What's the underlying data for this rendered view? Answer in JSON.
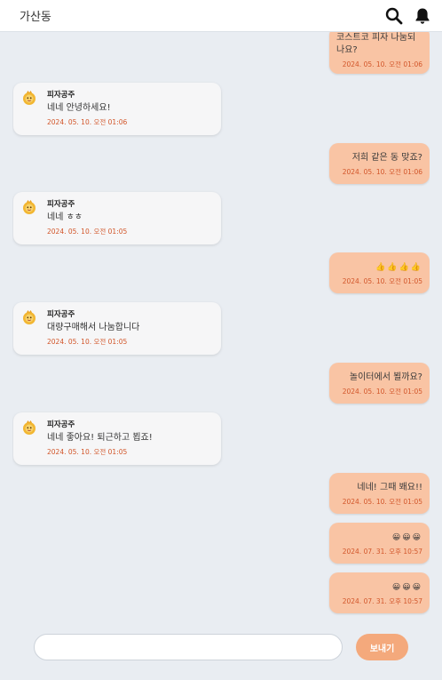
{
  "header": {
    "title": "가산동",
    "search_icon": "search-icon",
    "bell_icon": "bell-icon"
  },
  "colors": {
    "mine_bubble": "#f9c4a4",
    "theirs_bubble": "#f6f6f7",
    "timestamp": "#d2562a",
    "send_button": "#f4a97c"
  },
  "messages": [
    {
      "side": "mine",
      "text": "코스트코 피자 나눔되나요?",
      "time": "2024. 05. 10. 오전 01:06"
    },
    {
      "side": "theirs",
      "sender": "피자공주",
      "text": "네네 안녕하세요!",
      "time": "2024. 05. 10. 오전 01:06"
    },
    {
      "side": "mine",
      "text": "저희 같은 동 맞죠?",
      "time": "2024. 05. 10. 오전 01:06"
    },
    {
      "side": "theirs",
      "sender": "피자공주",
      "text": "네네 ㅎㅎ",
      "time": "2024. 05. 10. 오전 01:05"
    },
    {
      "side": "mine",
      "text": "👍👍👍👍",
      "time": "2024. 05. 10. 오전 01:05"
    },
    {
      "side": "theirs",
      "sender": "피자공주",
      "text": "대량구매해서 나눔합니다",
      "time": "2024. 05. 10. 오전 01:05"
    },
    {
      "side": "mine",
      "text": "놀이터에서 뵐까요?",
      "time": "2024. 05. 10. 오전 01:05"
    },
    {
      "side": "theirs",
      "sender": "피자공주",
      "text": "네네 좋아요! 퇴근하고 뵙죠!",
      "time": "2024. 05. 10. 오전 01:05"
    },
    {
      "side": "mine",
      "text": "네네! 그때 봬요!!",
      "time": "2024. 05. 10. 오전 01:05"
    },
    {
      "side": "mine",
      "text": "😀😀😀",
      "time": "2024. 07. 31. 오후 10:57"
    },
    {
      "side": "mine",
      "text": "😀😀😀",
      "time": "2024. 07. 31. 오후 10:57"
    }
  ],
  "composer": {
    "placeholder": "",
    "send_label": "보내기"
  }
}
